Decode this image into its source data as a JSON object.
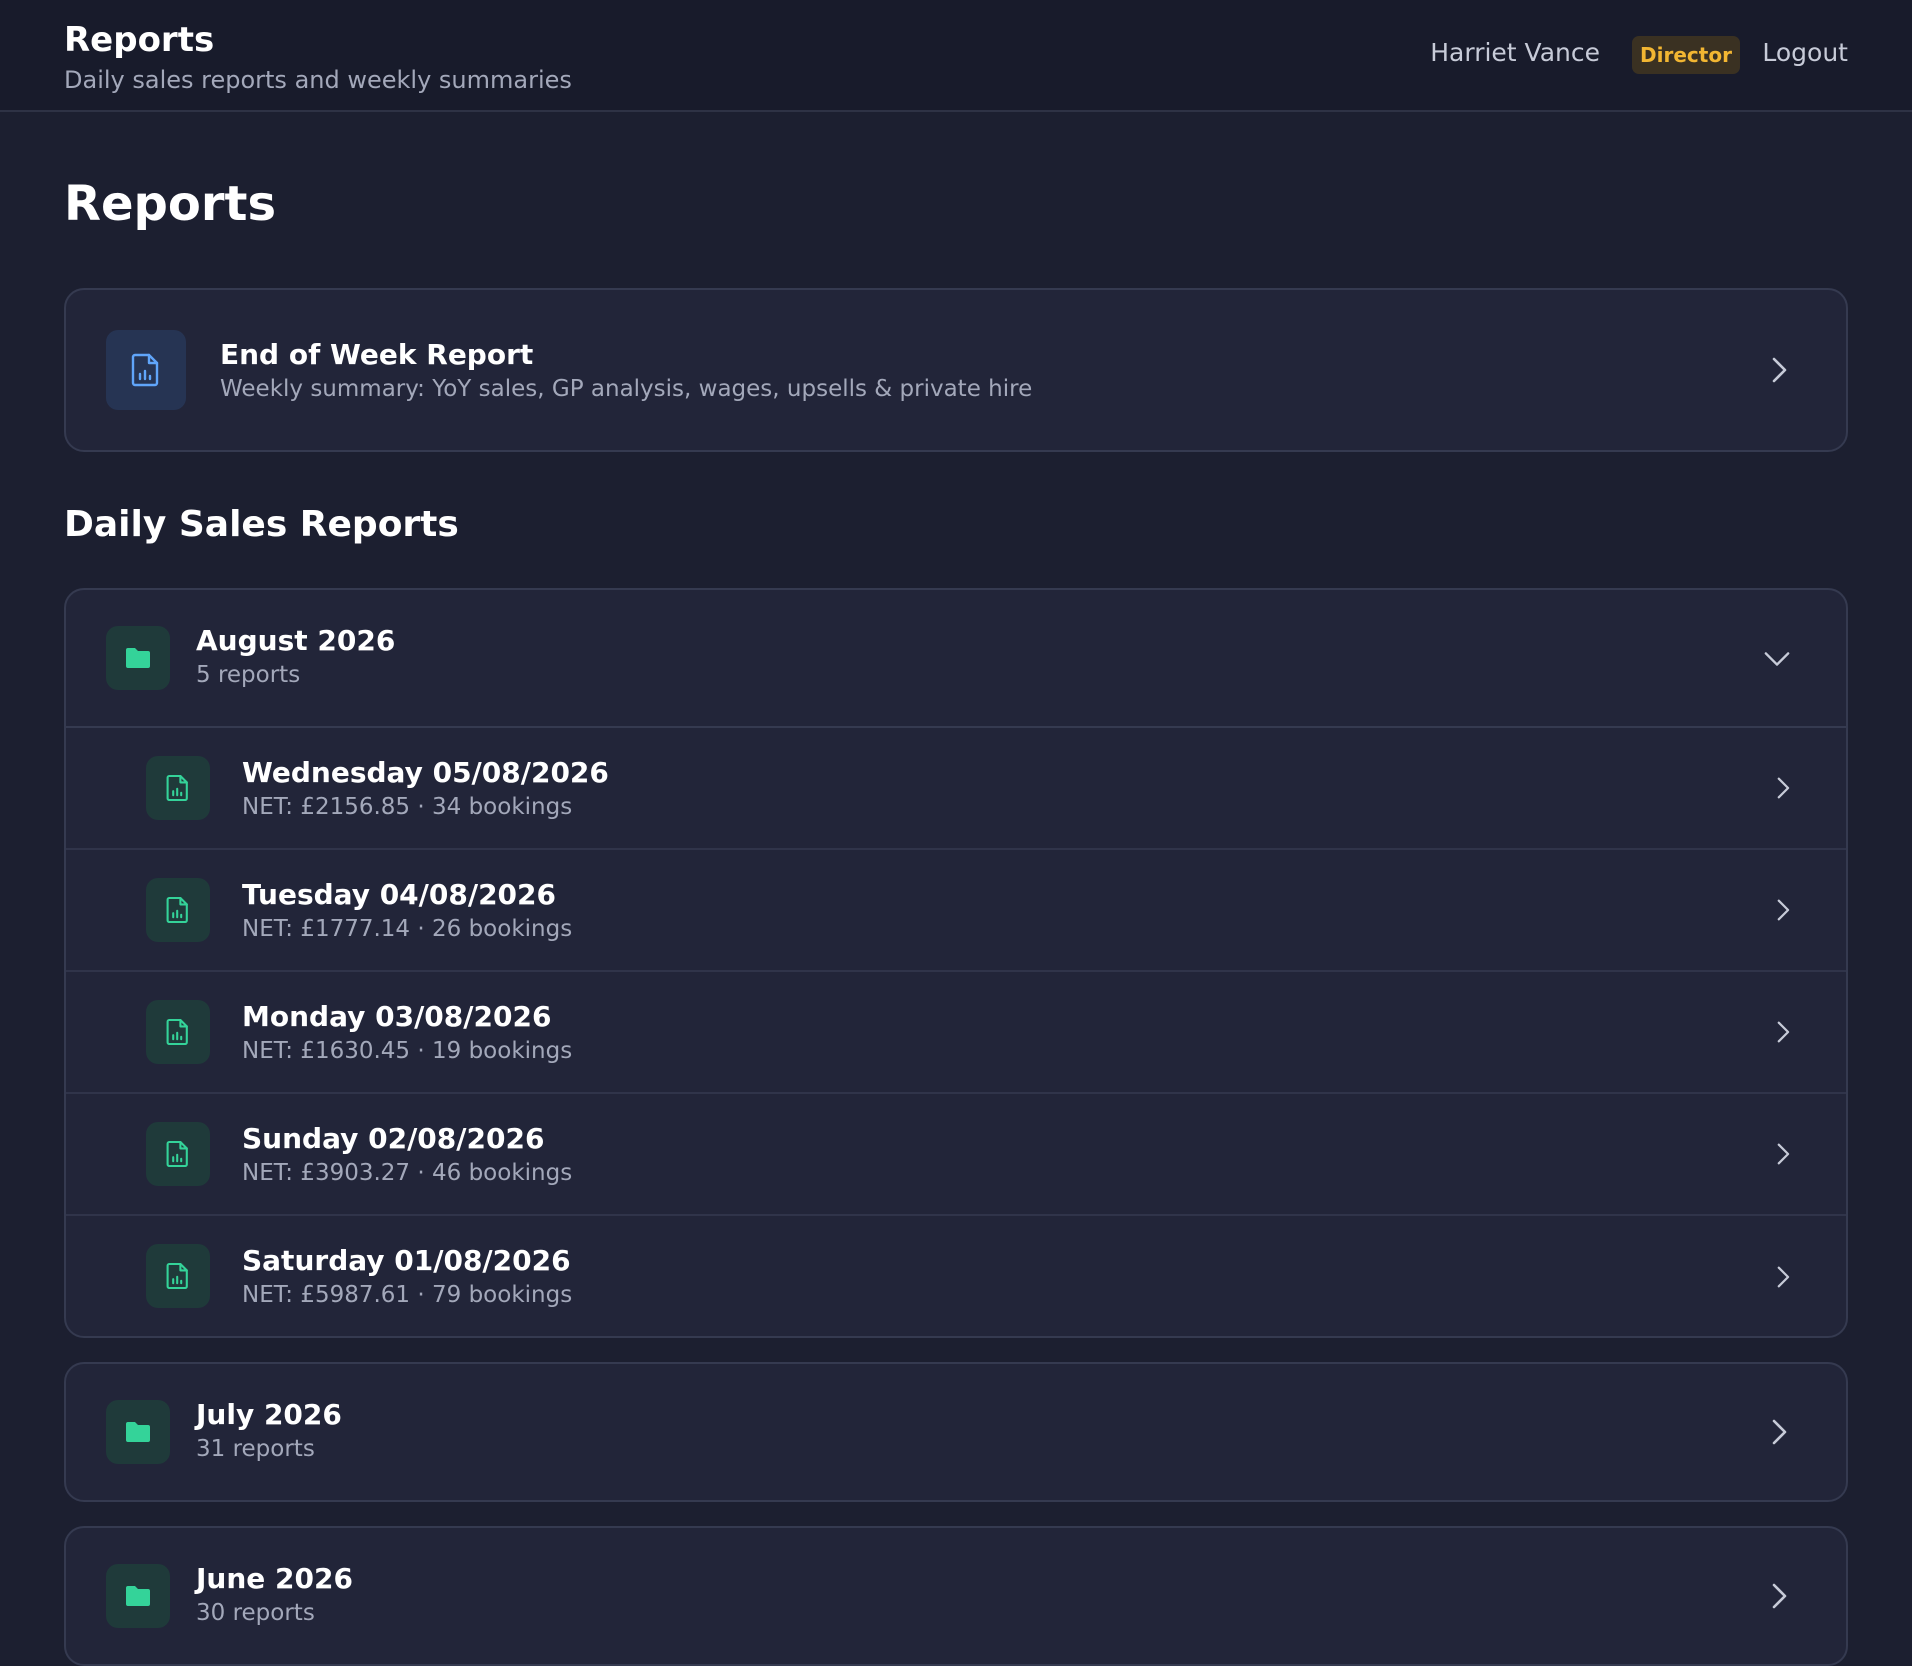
{
  "header": {
    "title": "Reports",
    "subtitle": "Daily sales reports and weekly summaries",
    "user_name": "Harriet Vance",
    "role": "Director",
    "logout_label": "Logout"
  },
  "page": {
    "title": "Reports"
  },
  "end_of_week": {
    "title": "End of Week Report",
    "subtitle": "Weekly summary: YoY sales, GP analysis, wages, upsells & private hire",
    "icon": "report-chart-icon"
  },
  "daily": {
    "section_title": "Daily Sales Reports",
    "months": [
      {
        "name": "August 2026",
        "count": "5 reports",
        "expanded": true,
        "days": [
          {
            "title": "Wednesday 05/08/2026",
            "summary": "NET: £2156.85 · 34 bookings"
          },
          {
            "title": "Tuesday 04/08/2026",
            "summary": "NET: £1777.14 · 26 bookings"
          },
          {
            "title": "Monday 03/08/2026",
            "summary": "NET: £1630.45 · 19 bookings"
          },
          {
            "title": "Sunday 02/08/2026",
            "summary": "NET: £3903.27 · 46 bookings"
          },
          {
            "title": "Saturday 01/08/2026",
            "summary": "NET: £5987.61 · 79 bookings"
          }
        ]
      },
      {
        "name": "July 2026",
        "count": "31 reports",
        "expanded": false
      },
      {
        "name": "June 2026",
        "count": "30 reports",
        "expanded": false
      }
    ]
  },
  "colors": {
    "background": "#1c1f30",
    "card": "#222539",
    "accent_green": "#34d399",
    "accent_blue": "#60a5fa",
    "badge_gold": "#f2b632"
  }
}
